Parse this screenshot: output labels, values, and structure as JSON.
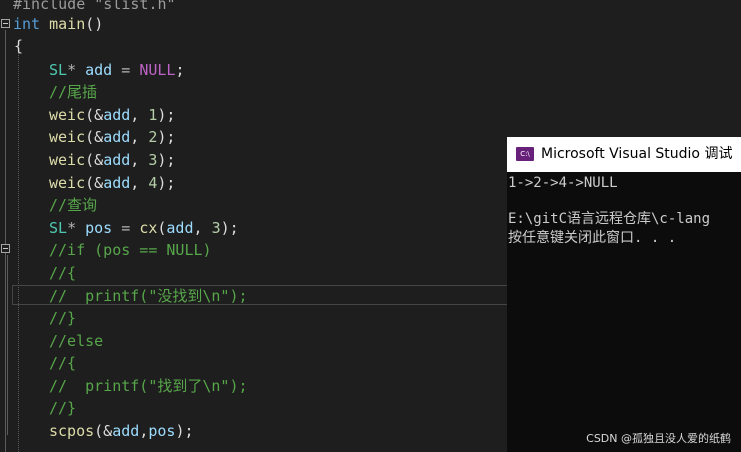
{
  "editor": {
    "line_include": "#include \"slist.h\"",
    "main_keyword": "int",
    "main_name": "main",
    "main_parens": "()",
    "brace_open": "{",
    "decl_type": "SL",
    "decl_ptr": "* ",
    "decl_var": "add",
    "decl_eq": " = ",
    "decl_null": "NULL",
    "decl_semi": ";",
    "comment_tail": "//尾插",
    "weic_fn": "weic",
    "weic_open": "(&",
    "weic_var": "add",
    "weic_sep": ", ",
    "weic_close": ");",
    "weic_args": [
      "1",
      "2",
      "3",
      "4"
    ],
    "comment_find": "//查询",
    "pos_type": "SL",
    "pos_ptr": "* ",
    "pos_var": "pos",
    "pos_eq": " = ",
    "pos_fn": "cx",
    "pos_open": "(",
    "pos_arg_var": "add",
    "pos_sep": ", ",
    "pos_num": "3",
    "pos_close": ");",
    "comment_if": "//if (pos == NULL)",
    "comment_brace_open_1": "//{",
    "comment_printf_1": "//  printf(\"没找到\\n\");",
    "comment_brace_close_1": "//}",
    "comment_else": "//else",
    "comment_brace_open_2": "//{",
    "comment_printf_2": "//  printf(\"找到了\\n\");",
    "comment_brace_close_2": "//}",
    "scpos_fn": "scpos",
    "scpos_open": "(&",
    "scpos_var1": "add",
    "scpos_sep": ",",
    "scpos_var2": "pos",
    "scpos_close": ");"
  },
  "console": {
    "logo": "C:\\",
    "title": "Microsoft Visual Studio 调试",
    "output": "1->2->4->NULL",
    "path": "E:\\gitC语言远程仓库\\c-lang",
    "prompt": "按任意键关闭此窗口. . ."
  },
  "watermark": "CSDN @孤独且没人爱的纸鹤"
}
